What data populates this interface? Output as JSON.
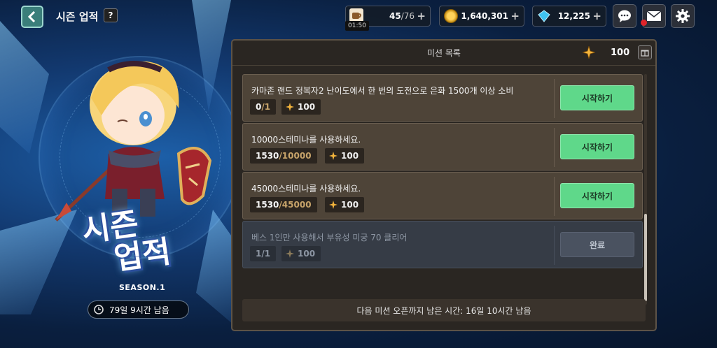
{
  "header": {
    "title": "시즌 업적",
    "help_label": "?"
  },
  "resources": {
    "stamina": {
      "current": "45",
      "max": "/76",
      "timer": "01:50",
      "icon": "coffee-cup-icon"
    },
    "coins": {
      "value": "1,640,301",
      "icon": "coin-icon"
    },
    "gems": {
      "value": "12,225",
      "icon": "diamond-icon"
    },
    "plus": "+"
  },
  "season": {
    "title_line1": "시즌",
    "title_line2": "업적",
    "subtitle": "SEASON.1",
    "time_left": "79일 9시간 남음"
  },
  "panel": {
    "title": "미션 목록",
    "points": "100"
  },
  "missions": [
    {
      "text": "카마존 랜드 정복자2 난이도에서 한 번의 도전으로 은화 1500개 이상 소비",
      "current": "0",
      "target": "/1",
      "reward": "100",
      "button": "시작하기",
      "done": false
    },
    {
      "text": "10000스테미나를 사용하세요.",
      "current": "1530",
      "target": "/10000",
      "reward": "100",
      "button": "시작하기",
      "done": false
    },
    {
      "text": "45000스테미나를 사용하세요.",
      "current": "1530",
      "target": "/45000",
      "reward": "100",
      "button": "시작하기",
      "done": false
    },
    {
      "text": "베스 1인만 사용해서 부유성 미궁 70 클리어",
      "current": "1",
      "target": "/1",
      "reward": "100",
      "button": "완료",
      "done": true
    }
  ],
  "footer": {
    "next_mission": "다음 미션 오픈까지 남은 시간: 16일 10시간 남음"
  },
  "colors": {
    "start_button": "#5fd88a",
    "panel_bg": "#2a2622",
    "mission_bg": "#4e4438",
    "done_bg": "#363c46",
    "star": "#f3b43c"
  }
}
